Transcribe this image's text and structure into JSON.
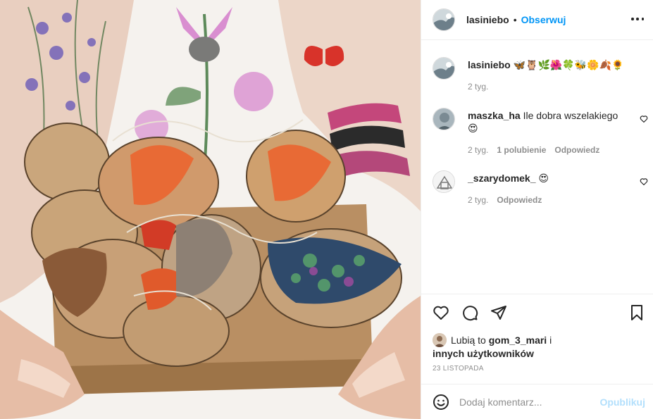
{
  "post": {
    "username": "lasiniebo",
    "separator": "•",
    "follow_label": "Obserwuj"
  },
  "caption": {
    "username": "lasiniebo",
    "emojis": "🦋🦉🌿🌺🍀🐝🌼🍂🌻",
    "time": "2 tyg."
  },
  "comments": [
    {
      "username": "maszka_ha",
      "text": "Ile dobra wszelakiego",
      "emoji": "😍",
      "time": "2 tyg.",
      "likes": "1 polubienie",
      "reply": "Odpowiedz"
    },
    {
      "username": "_szarydomek_",
      "text": "",
      "emoji": "😍",
      "time": "2 tyg.",
      "reply": "Odpowiedz"
    }
  ],
  "likes": {
    "prefix": "Lubią to",
    "user": "gom_3_mari",
    "joiner": "i",
    "others": "innych użytkowników"
  },
  "date": "23 listopada",
  "add_comment": {
    "placeholder": "Dodaj komentarz...",
    "publish_label": "Opublikuj"
  },
  "icons": {
    "more": "more-options-icon",
    "heart": "heart-icon",
    "comment": "comment-icon",
    "share": "share-icon",
    "save": "bookmark-icon",
    "emoji": "emoji-icon"
  },
  "colors": {
    "link": "#0095f6",
    "publish_disabled": "#b2dffc",
    "meta": "#8e8e8e",
    "text": "#262626"
  }
}
